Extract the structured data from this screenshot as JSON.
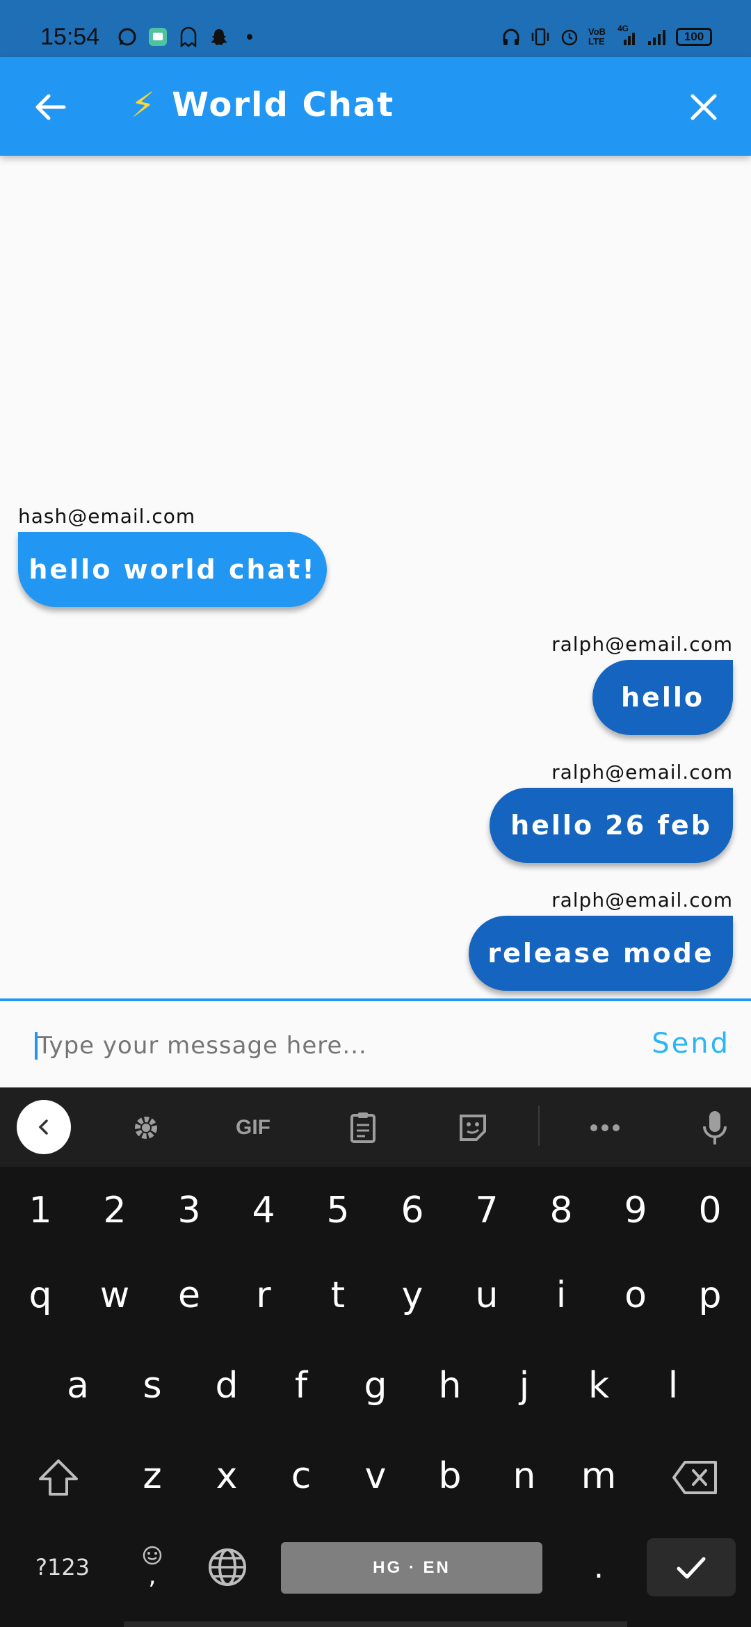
{
  "status_bar": {
    "time": "15:54",
    "volte": "VoB LTE",
    "net": "4G",
    "battery": "100"
  },
  "app_bar": {
    "emoji": "⚡",
    "title": "World Chat"
  },
  "messages": [
    {
      "sender": "hash@email.com",
      "text": "hello world chat!",
      "mine": false
    },
    {
      "sender": "ralph@email.com",
      "text": "hello",
      "mine": true
    },
    {
      "sender": "ralph@email.com",
      "text": "hello 26 feb",
      "mine": true
    },
    {
      "sender": "ralph@email.com",
      "text": "release mode",
      "mine": true
    }
  ],
  "input": {
    "placeholder": "Type your message here...",
    "send_label": "Send"
  },
  "keyboard": {
    "toolbar": {
      "gif": "GIF"
    },
    "numbers": [
      "1",
      "2",
      "3",
      "4",
      "5",
      "6",
      "7",
      "8",
      "9",
      "0"
    ],
    "row1": [
      "q",
      "w",
      "e",
      "r",
      "t",
      "y",
      "u",
      "i",
      "o",
      "p"
    ],
    "row2": [
      "a",
      "s",
      "d",
      "f",
      "g",
      "h",
      "j",
      "k",
      "l"
    ],
    "row3": [
      "z",
      "x",
      "c",
      "v",
      "b",
      "n",
      "m"
    ],
    "symbols_label": "?123",
    "emoji_comma": ",",
    "space_label": "HG · EN",
    "period": "."
  },
  "colors": {
    "status_bar": "#1e6fb6",
    "app_bar": "#2196f3",
    "bubble_other": "#2196f3",
    "bubble_mine": "#1565c0",
    "send": "#29b6f6"
  }
}
